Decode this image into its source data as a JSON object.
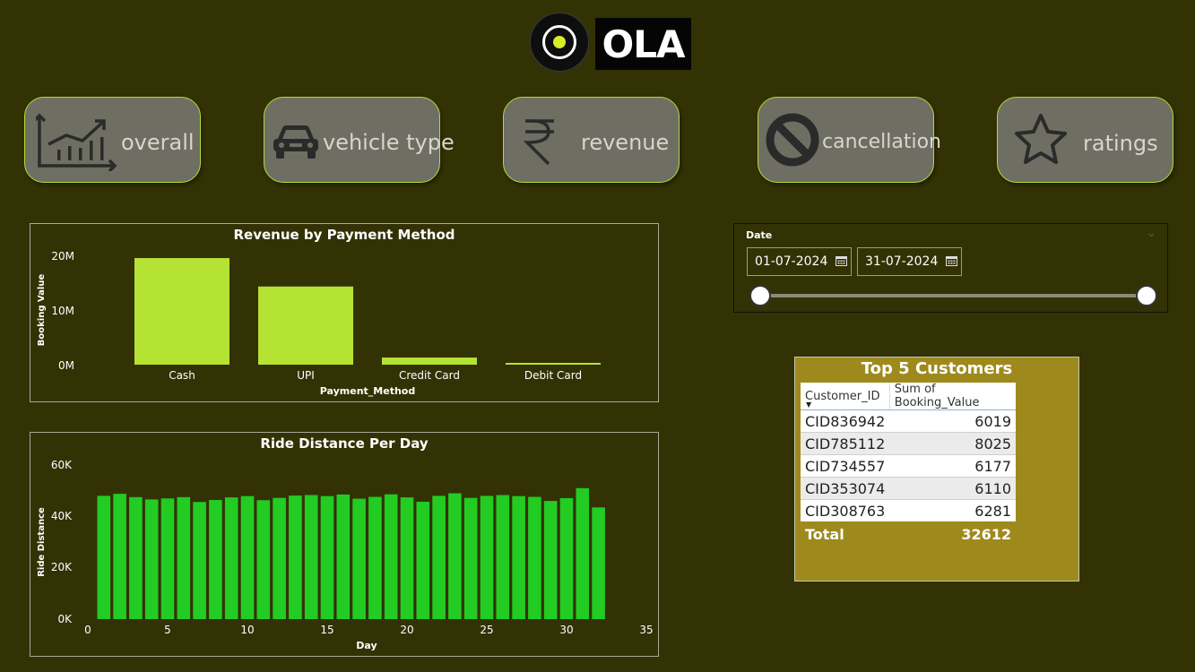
{
  "logo": {
    "text": "OLA"
  },
  "nav": [
    {
      "label": "overall",
      "icon": "line-chart-icon"
    },
    {
      "label": "vehicle type",
      "icon": "car-icon"
    },
    {
      "label": "revenue",
      "icon": "rupee-icon"
    },
    {
      "label": "cancellation",
      "icon": "prohibited-icon"
    },
    {
      "label": "ratings",
      "icon": "star-icon"
    }
  ],
  "revenue_chart": {
    "title": "Revenue by Payment Method",
    "xlabel": "Payment_Method",
    "ylabel": "Booking Value",
    "yticks": [
      "20M",
      "10M",
      "0M"
    ]
  },
  "distance_chart": {
    "title": "Ride Distance Per Day",
    "xlabel": "Day",
    "ylabel": "Ride Distance",
    "yticks": [
      "60K",
      "40K",
      "20K",
      "0K"
    ],
    "xticks": [
      "0",
      "5",
      "10",
      "15",
      "20",
      "25",
      "30",
      "35"
    ]
  },
  "chart_data": [
    {
      "type": "bar",
      "title": "Revenue by Payment Method",
      "xlabel": "Payment_Method",
      "ylabel": "Booking Value",
      "categories": [
        "Cash",
        "UPI",
        "Credit Card",
        "Debit Card"
      ],
      "values": [
        19500000,
        14300000,
        1300000,
        300000
      ],
      "ylim": [
        0,
        21000000
      ],
      "color": "#b5e334"
    },
    {
      "type": "bar",
      "title": "Ride Distance Per Day",
      "xlabel": "Day",
      "ylabel": "Ride Distance",
      "x": [
        1,
        2,
        3,
        4,
        5,
        6,
        7,
        8,
        9,
        10,
        11,
        12,
        13,
        14,
        15,
        16,
        17,
        18,
        19,
        20,
        21,
        22,
        23,
        24,
        25,
        26,
        27,
        28,
        29,
        30,
        31
      ],
      "values": [
        48000,
        48800,
        47500,
        46600,
        47000,
        47500,
        45600,
        46400,
        47400,
        47900,
        46300,
        47200,
        48100,
        48300,
        47900,
        48500,
        46900,
        47600,
        48600,
        47400,
        45700,
        48000,
        49000,
        47200,
        48000,
        48300,
        47900,
        47600,
        46000,
        47100,
        51000,
        43500
      ],
      "ylim": [
        0,
        60000
      ],
      "xlim": [
        0,
        35
      ],
      "color": "#22cc22"
    }
  ],
  "date_slicer": {
    "label": "Date",
    "start": "01-07-2024",
    "end": "31-07-2024"
  },
  "top_customers": {
    "title": "Top 5 Customers",
    "columns": [
      "Customer_ID",
      "Sum of Booking_Value"
    ],
    "rows": [
      [
        "CID836942",
        "6019"
      ],
      [
        "CID785112",
        "8025"
      ],
      [
        "CID734557",
        "6177"
      ],
      [
        "CID353074",
        "6110"
      ],
      [
        "CID308763",
        "6281"
      ]
    ],
    "total_label": "Total",
    "total_value": "32612"
  }
}
